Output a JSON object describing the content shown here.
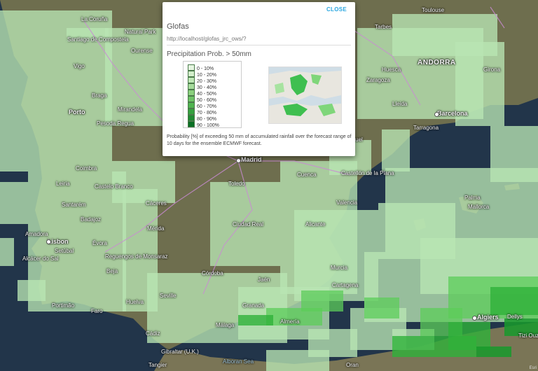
{
  "popup": {
    "close_label": "CLOSE",
    "title": "Glofas",
    "url": "http://localhost/glofas_jrc_ows/?",
    "layer_title": "Precipitation Prob. > 50mm",
    "legend": [
      {
        "label": "0 - 10%",
        "color": "#e5f5e0"
      },
      {
        "label": "10 - 20%",
        "color": "#d3efcb"
      },
      {
        "label": "20 - 30%",
        "color": "#c0e8b7"
      },
      {
        "label": "30 - 40%",
        "color": "#a6dc9c"
      },
      {
        "label": "40 - 50%",
        "color": "#8bd07e"
      },
      {
        "label": "50 - 60%",
        "color": "#6ec367"
      },
      {
        "label": "60 - 70%",
        "color": "#4fb44f"
      },
      {
        "label": "70 - 80%",
        "color": "#35a13f"
      },
      {
        "label": "80 - 90%",
        "color": "#1f8b31"
      },
      {
        "label": "90 - 100%",
        "color": "#0a7024"
      }
    ],
    "description": "Probability [%] of exceeding 50 mm of accumulated rainfall over the forecast range of 10 days for the ensemble ECMWF forecast."
  },
  "map": {
    "countries": [
      "ANDORRA"
    ],
    "seas": [
      "Alboran Sea"
    ],
    "cities": [
      "La Coruña",
      "Natural Park",
      "Santiago de Compostela",
      "Ourense",
      "Vigo",
      "Porto",
      "Braga",
      "Mirandela",
      "Pesoda Regua",
      "Coimbra",
      "Leiria",
      "Castelo Branco",
      "Santarém",
      "Amadora",
      "Lisbon",
      "Setúbal",
      "Alcácer do Sal",
      "Évora",
      "Reguengos de Monsaraz",
      "Beja",
      "Portimão",
      "Faro",
      "Huelva",
      "Seville",
      "Cádiz",
      "Gibraltar (U.K.)",
      "Tangier",
      "Málaga",
      "Granada",
      "Almería",
      "Cartagena",
      "Murcia",
      "Alicante",
      "Valencia",
      "Castellón de la Plana",
      "Cuenca",
      "Toledo",
      "Madrid",
      "Cáceres",
      "Mérida",
      "Ciudad Real",
      "Córdoba",
      "Jaén",
      "Badajoz",
      "Teruel",
      "Lleida",
      "Barcelona",
      "Tarragona",
      "Palma",
      "Mallorca",
      "Toulouse",
      "Tarbes",
      "Girona",
      "Algiers",
      "Dellys",
      "Tizi Ouzou",
      "Oran",
      "Zaragoza",
      "Huesca"
    ],
    "attribution": "Esri"
  }
}
